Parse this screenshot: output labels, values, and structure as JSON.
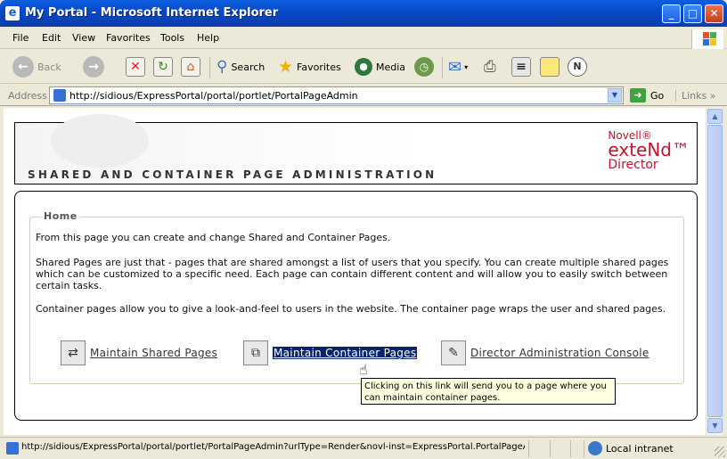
{
  "window": {
    "title": "My Portal - Microsoft Internet Explorer",
    "ie_icon": "e",
    "minimize": "_",
    "maximize": "□",
    "close": "✕"
  },
  "menu": {
    "items": [
      "File",
      "Edit",
      "View",
      "Favorites",
      "Tools",
      "Help"
    ]
  },
  "toolbar": {
    "back_label": "Back",
    "search_label": "Search",
    "favorites_label": "Favorites",
    "media_label": "Media"
  },
  "address": {
    "label": "Address",
    "url": "http://sidious/ExpressPortal/portal/portlet/PortalPageAdmin",
    "go_label": "Go",
    "links_label": "Links"
  },
  "page": {
    "heading": "SHARED AND CONTAINER PAGE ADMINISTRATION",
    "brand": {
      "line1": "Novell®",
      "line2": "exteNd™",
      "line3": "Director",
      "color": "#c8102e"
    },
    "section_title": "Home",
    "paragraphs": [
      "From this page you can create and change Shared and Container Pages.",
      "Shared Pages are just that - pages that are shared amongst a list of users that you specify. You can create multiple shared pages which can be customized to a specific need. Each page can contain different content and will allow you to easily switch between certain tasks.",
      "Container pages allow you to give a look-and-feel to users in the website. The container page wraps the user and shared pages."
    ],
    "links": [
      {
        "label": "Maintain Shared Pages",
        "icon": "shared-pages-icon"
      },
      {
        "label": "Maintain Container Pages",
        "icon": "container-pages-icon",
        "selected": true
      },
      {
        "label": "Director Administration Console",
        "icon": "admin-console-icon"
      }
    ],
    "tooltip": "Clicking on this link will send you to a page where you can maintain container pages."
  },
  "status": {
    "text": "http://sidious/ExpressPortal/portal/portlet/PortalPageAdmin?urlType=Render&novl-inst=ExpressPortal.PortalPageAc",
    "zone": "Local intranet"
  }
}
